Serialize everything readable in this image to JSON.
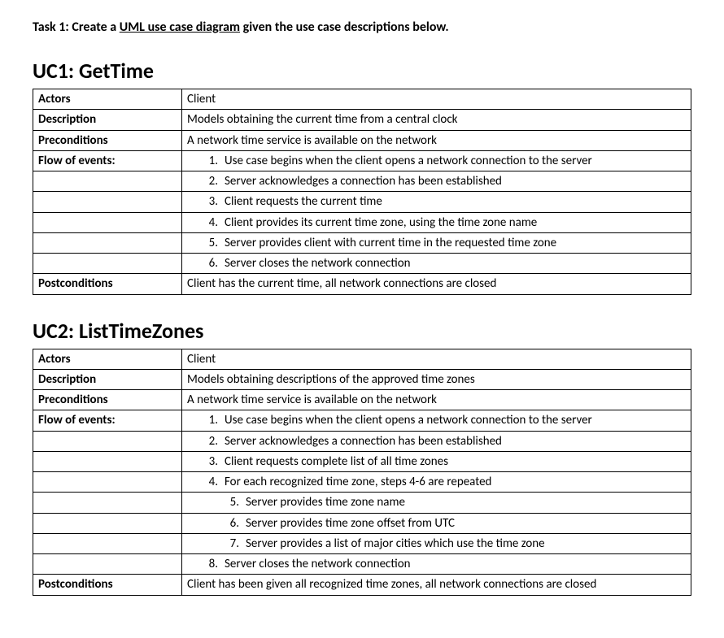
{
  "task": {
    "prefix": "Task 1: Create a ",
    "underlined": "UML use case diagram",
    "suffix": " given the use case descriptions below."
  },
  "uc1": {
    "title": "UC1: GetTime",
    "actors_label": "Actors",
    "actors": "Client",
    "description_label": "Description",
    "description": "Models obtaining the current time from a central clock",
    "preconditions_label": "Preconditions",
    "preconditions": "A network time service is available on the network",
    "flow_label": "Flow of events:",
    "flow": [
      {
        "n": "1.",
        "text": "Use case begins when the client opens a network connection to the server",
        "indent": 1
      },
      {
        "n": "2.",
        "text": "Server acknowledges a connection has been established",
        "indent": 1
      },
      {
        "n": "3.",
        "text": "Client requests the current time",
        "indent": 1
      },
      {
        "n": "4.",
        "text": "Client provides its current time zone, using the time zone name",
        "indent": 1
      },
      {
        "n": "5.",
        "text": "Server provides client with current time in the requested time zone",
        "indent": 1
      },
      {
        "n": "6.",
        "text": "Server closes the network connection",
        "indent": 1
      }
    ],
    "postconditions_label": "Postconditions",
    "postconditions": "Client has the current time, all network connections are closed"
  },
  "uc2": {
    "title": "UC2: ListTimeZones",
    "actors_label": "Actors",
    "actors": "Client",
    "description_label": "Description",
    "description": "Models obtaining descriptions of the approved time zones",
    "preconditions_label": "Preconditions",
    "preconditions": "A network time service is available on the network",
    "flow_label": "Flow of events:",
    "flow": [
      {
        "n": "1.",
        "text": "Use case begins when the client opens a network connection to the server",
        "indent": 1
      },
      {
        "n": "2.",
        "text": "Server acknowledges a connection has been established",
        "indent": 1
      },
      {
        "n": "3.",
        "text": "Client requests complete list of all time zones",
        "indent": 1
      },
      {
        "n": "4.",
        "text": "For each recognized time zone, steps 4-6 are repeated",
        "indent": 1
      },
      {
        "n": "5.",
        "text": "Server provides time zone name",
        "indent": 2
      },
      {
        "n": "6.",
        "text": "Server provides time zone offset from UTC",
        "indent": 2
      },
      {
        "n": "7.",
        "text": "Server provides a list of major cities which use the time zone",
        "indent": 2
      },
      {
        "n": "8.",
        "text": "Server closes the network connection",
        "indent": 1
      }
    ],
    "postconditions_label": "Postconditions",
    "postconditions": "Client has been given all recognized time zones, all network connections are closed"
  }
}
